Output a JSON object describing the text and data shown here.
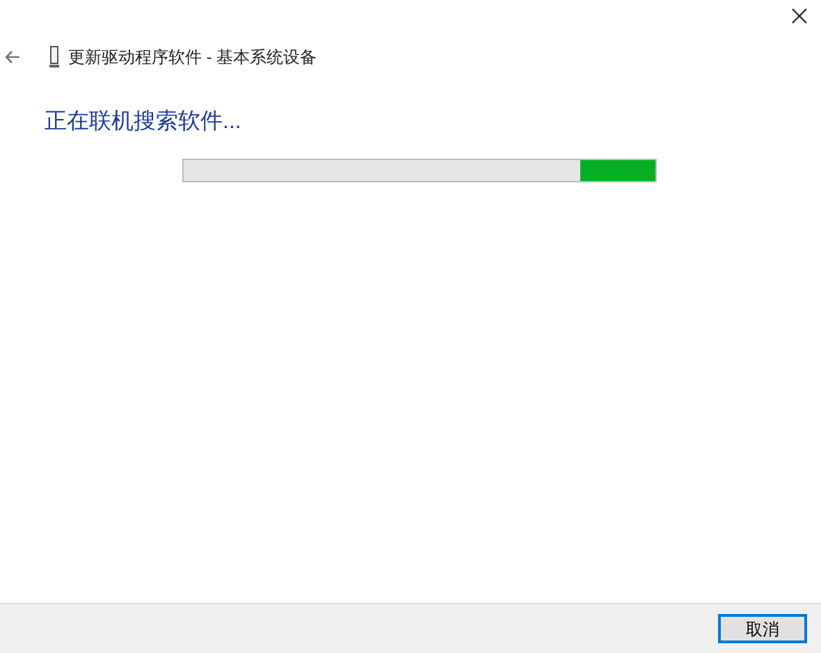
{
  "window": {
    "title": "更新驱动程序软件 - 基本系统设备"
  },
  "heading": "正在联机搜索软件...",
  "progress": {
    "kind": "marquee",
    "level": 0.16
  },
  "buttons": [
    {
      "label": "取消",
      "focused": true
    }
  ]
}
